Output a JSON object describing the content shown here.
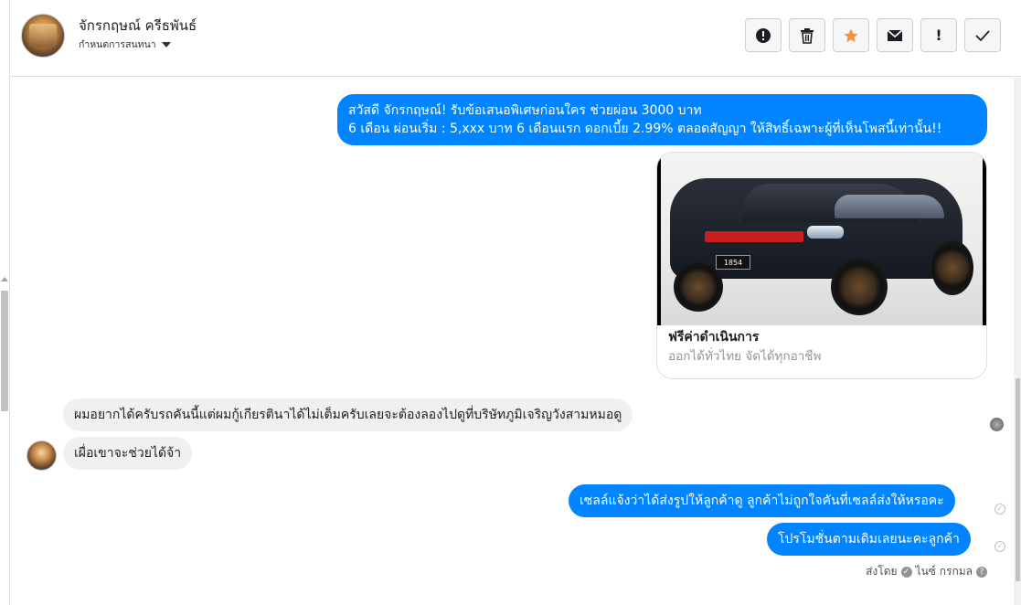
{
  "header": {
    "name": "จักรกฤษณ์ ครีธพันธ์",
    "subtitle": "กำหนดการสนทนา",
    "toolbar": {
      "report_icon": "!",
      "trash_icon": "🗑",
      "star_icon": "★",
      "mail_icon": "✉",
      "important_icon": "!",
      "done_icon": "✓"
    }
  },
  "messages": {
    "outgoing_1": {
      "line1": "สวัสดี จักรกฤษณ์! รับข้อเสนอพิเศษก่อนใคร ช่วยผ่อน 3000 บาท",
      "line2": " 6 เดือน ผ่อนเริ่ม : 5,xxx บาท 6 เดือนแรก ดอกเบี้ย 2.99% ตลอดสัญญา ให้สิทธิ์เฉพาะผู้ที่เห็นโพสนี้เท่านั้น!!"
    },
    "card": {
      "plate": "1854",
      "title": "ฟรีค่าดำเนินการ",
      "subtitle": "ออกได้ทั่วไทย จัดได้ทุกอาชีพ"
    },
    "incoming_1": "ผมอยากได้ครับรถคันนี้แต่ผมกู้เกียรตินาได้ไม่เต็มครับเลยจะต้องลองไปดูที่บริษัทภูมิเจริญวังสามหมอดู",
    "incoming_2": "เผื่อเขาจะช่วยได้จ้า",
    "outgoing_2": "เซลล์แจ้งว่าได้ส่งรูปให้ลูกค้าดู ลูกค้าไม่ถูกใจคันที่เซลล์ส่งให้หรอคะ",
    "outgoing_3": "โปรโมชั่นตามเดิมเลยนะคะลูกค้า",
    "sent_by_label": "ส่งโดย",
    "sent_by_name": "ไนซ์ กรกมล"
  },
  "colors": {
    "outgoing": "#0084ff",
    "incoming": "#f1f0f0",
    "star": "#f7923a"
  }
}
